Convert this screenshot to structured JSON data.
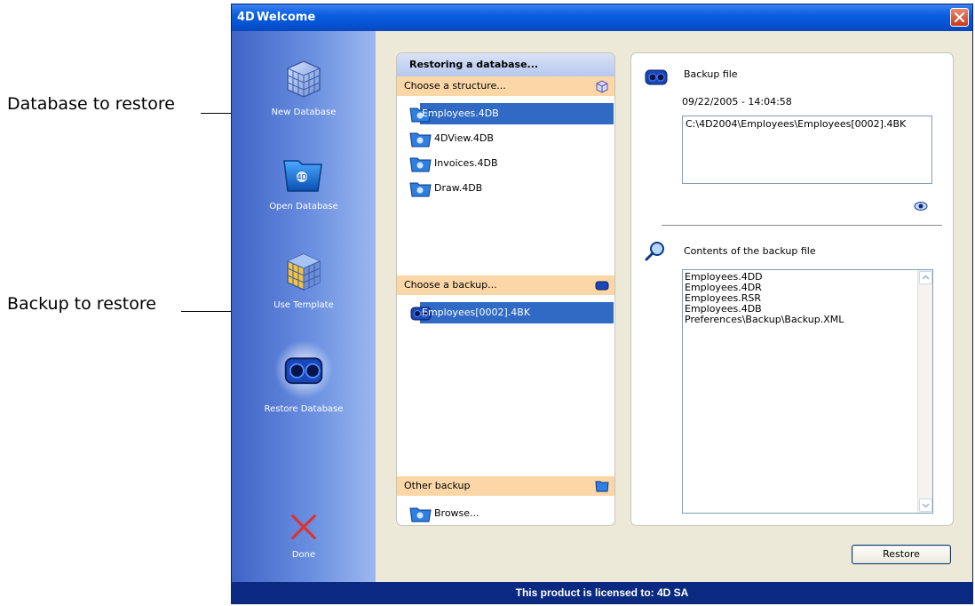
{
  "callouts": {
    "database_to_restore": "Database to restore",
    "backup_to_restore": "Backup to restore"
  },
  "window": {
    "logo": "4D",
    "title": "Welcome",
    "close_icon": "close-icon"
  },
  "sidebar": {
    "items": [
      {
        "label": "New Database",
        "icon": "new-database-icon"
      },
      {
        "label": "Open Database",
        "icon": "open-database-icon"
      },
      {
        "label": "Use Template",
        "icon": "template-icon"
      },
      {
        "label": "Restore Database",
        "icon": "restore-database-icon"
      },
      {
        "label": "Done",
        "icon": "done-x-icon"
      }
    ]
  },
  "middle": {
    "header": "Restoring a database...",
    "structure_section": "Choose a structure...",
    "structures": [
      "Employees.4DB",
      "4DView.4DB",
      "Invoices.4DB",
      "Draw.4DB"
    ],
    "backup_section": "Choose a backup...",
    "backups": [
      "Employees[0002].4BK"
    ],
    "other_section": "Other backup",
    "browse": "Browse..."
  },
  "right": {
    "backup_file_label": "Backup file",
    "backup_date": "09/22/2005 - 14:04:58",
    "backup_path": "C:\\4D2004\\Employees\\Employees[0002].4BK",
    "contents_label": "Contents of the backup file",
    "contents": [
      "Employees.4DD",
      "Employees.4DR",
      "Employees.RSR",
      "Employees.4DB",
      "Preferences\\Backup\\Backup.XML"
    ]
  },
  "restore_button": "Restore",
  "footer": "This product is licensed to: 4D SA",
  "colors": {
    "title_bar": "#0a5ede",
    "sidebar": "#6a8fe0",
    "section_head": "#fbd7a7",
    "selection": "#316ac5",
    "footer": "#0a2a82"
  }
}
